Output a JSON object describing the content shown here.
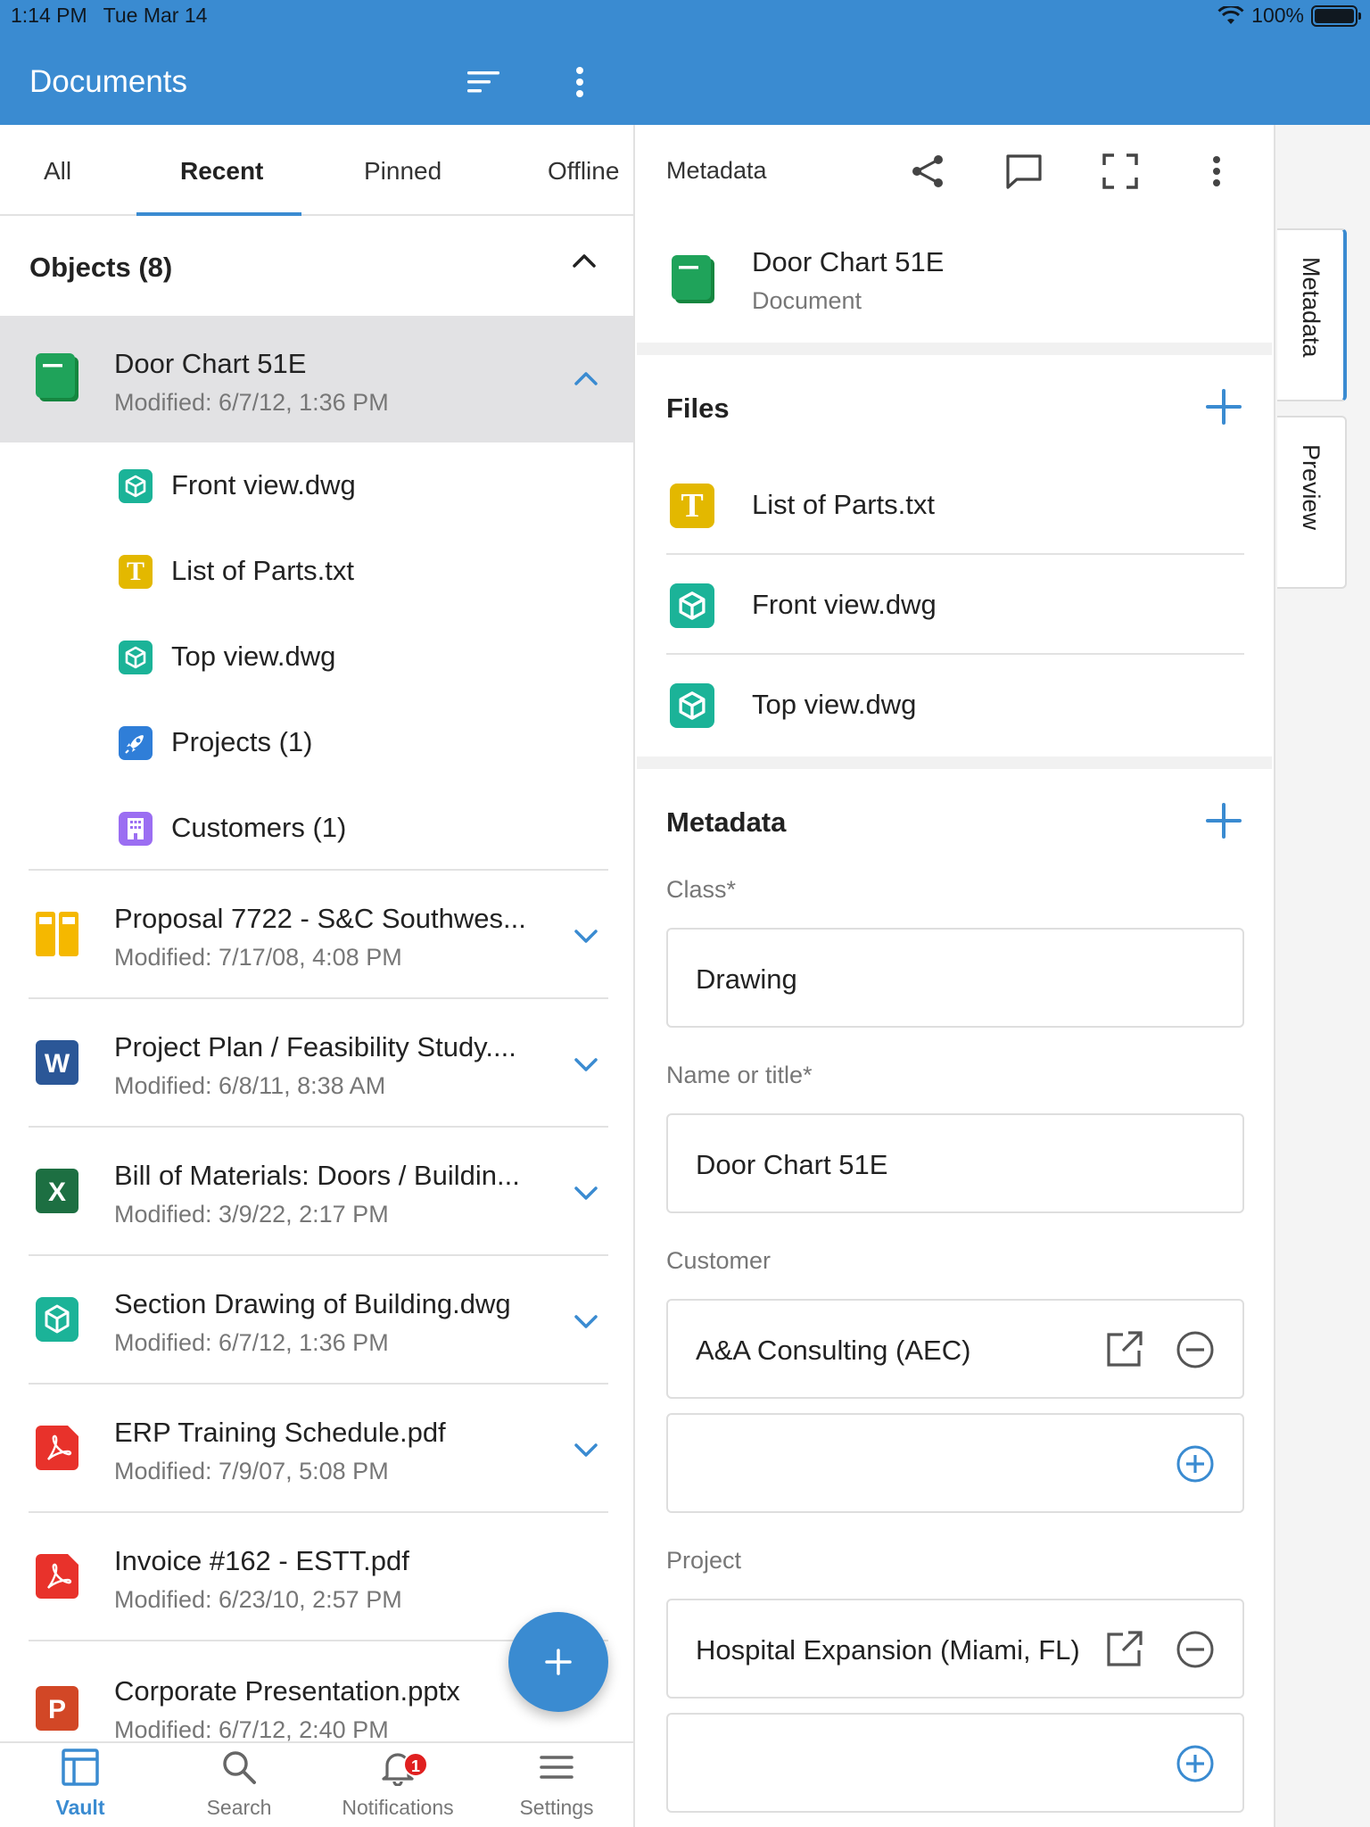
{
  "status": {
    "time": "1:14 PM",
    "date": "Tue Mar 14",
    "battery": "100%"
  },
  "appbar": {
    "title": "Documents",
    "sort_icon": "sort-icon",
    "more_icon": "more-vertical-icon"
  },
  "tabs": [
    {
      "label": "All"
    },
    {
      "label": "Recent"
    },
    {
      "label": "Pinned"
    },
    {
      "label": "Offline"
    }
  ],
  "objects_section": {
    "title": "Objects (8)"
  },
  "selected_object": {
    "name": "Door Chart 51E",
    "modified": "Modified: 6/7/12, 1:36 PM",
    "children": [
      {
        "name": "Front view.dwg",
        "icon": "cube-icon"
      },
      {
        "name": "List of Parts.txt",
        "icon": "text-file-icon"
      },
      {
        "name": "Top view.dwg",
        "icon": "cube-icon"
      },
      {
        "name": "Projects (1)",
        "icon": "rocket-icon"
      },
      {
        "name": "Customers (1)",
        "icon": "building-icon"
      }
    ]
  },
  "objects": [
    {
      "name": "Proposal 7722 - S&C Southwes...",
      "modified": "Modified: 7/17/08, 4:08 PM",
      "icon": "binder-icon"
    },
    {
      "name": "Project Plan / Feasibility Study....",
      "modified": "Modified: 6/8/11, 8:38 AM",
      "icon": "word-icon",
      "letter": "W"
    },
    {
      "name": "Bill of Materials: Doors / Buildin...",
      "modified": "Modified: 3/9/22, 2:17 PM",
      "icon": "excel-icon",
      "letter": "X"
    },
    {
      "name": "Section Drawing of Building.dwg",
      "modified": "Modified: 6/7/12, 1:36 PM",
      "icon": "cube-icon"
    },
    {
      "name": "ERP Training Schedule.pdf",
      "modified": "Modified: 7/9/07, 5:08 PM",
      "icon": "pdf-icon"
    },
    {
      "name": "Invoice #162 - ESTT.pdf",
      "modified": "Modified: 6/23/10, 2:57 PM",
      "icon": "pdf-icon"
    },
    {
      "name": "Corporate Presentation.pptx",
      "modified": "Modified: 6/7/12, 2:40 PM",
      "icon": "powerpoint-icon",
      "letter": "P"
    }
  ],
  "bottomnav": [
    {
      "label": "Vault",
      "icon": "vault-icon"
    },
    {
      "label": "Search",
      "icon": "search-icon"
    },
    {
      "label": "Notifications",
      "icon": "bell-icon",
      "badge": "1"
    },
    {
      "label": "Settings",
      "icon": "menu-icon"
    }
  ],
  "details": {
    "toolbar_title": "Metadata",
    "object_name": "Door Chart 51E",
    "object_type": "Document",
    "files_title": "Files",
    "files": [
      {
        "name": "List of Parts.txt",
        "icon": "text-file-icon"
      },
      {
        "name": "Front view.dwg",
        "icon": "cube-icon"
      },
      {
        "name": "Top view.dwg",
        "icon": "cube-icon"
      }
    ],
    "metadata_title": "Metadata",
    "fields": {
      "class_label": "Class*",
      "class_value": "Drawing",
      "name_label": "Name or title*",
      "name_value": "Door Chart 51E",
      "customer_label": "Customer",
      "customer_value": "A&A Consulting (AEC)",
      "project_label": "Project",
      "project_value": "Hospital Expansion (Miami, FL)"
    }
  },
  "sidetabs": [
    {
      "label": "Metadata"
    },
    {
      "label": "Preview"
    }
  ],
  "colors": {
    "accent": "#3a8bd1",
    "doc_green": "#1fa35a",
    "dwg_teal": "#1bb398",
    "txt_yellow": "#e3b800",
    "pdf_red": "#e8322b",
    "word_blue": "#2b5797",
    "excel_green": "#1d6f42",
    "ppt_orange": "#d24726"
  }
}
